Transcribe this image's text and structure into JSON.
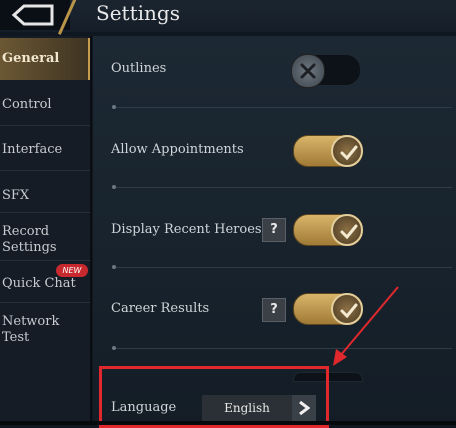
{
  "header": {
    "title": "Settings"
  },
  "sidebar": {
    "items": [
      {
        "label": "General"
      },
      {
        "label": "Control"
      },
      {
        "label": "Interface"
      },
      {
        "label": "SFX"
      },
      {
        "label": "Record Settings"
      },
      {
        "label": "Quick Chat",
        "badge": "NEW"
      },
      {
        "label": "Network Test"
      }
    ],
    "active_index": 0
  },
  "settings": {
    "outlines": {
      "label": "Outlines",
      "state": "off"
    },
    "allow_appointments": {
      "label": "Allow Appointments",
      "state": "on"
    },
    "display_recent_heroes": {
      "label": "Display Recent Heroes",
      "help": "?",
      "state": "on"
    },
    "career_results": {
      "label": "Career Results",
      "help": "?",
      "state": "on"
    },
    "language": {
      "label": "Language",
      "value": "English"
    }
  },
  "colors": {
    "accent_gold": "#c69c4e",
    "annotation_red": "#e0282d",
    "badge_red": "#c8292e"
  },
  "icons": [
    "back-icon",
    "x-icon",
    "check-icon",
    "chevron-right-icon"
  ]
}
